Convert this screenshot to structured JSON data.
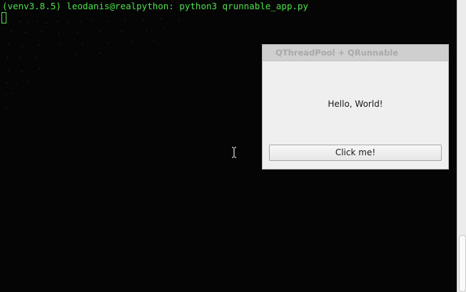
{
  "terminal": {
    "prompt": "(venv3.8.5) leodanis@realpython: python3 qrunnable_app.py",
    "text_color": "#4be04b",
    "background": "#050505"
  },
  "qt_window": {
    "title": "QThreadPool + QRunnable",
    "label": "Hello, World!",
    "button_label": "Click me!"
  },
  "icons": {
    "cursor": "text-cursor-icon"
  }
}
